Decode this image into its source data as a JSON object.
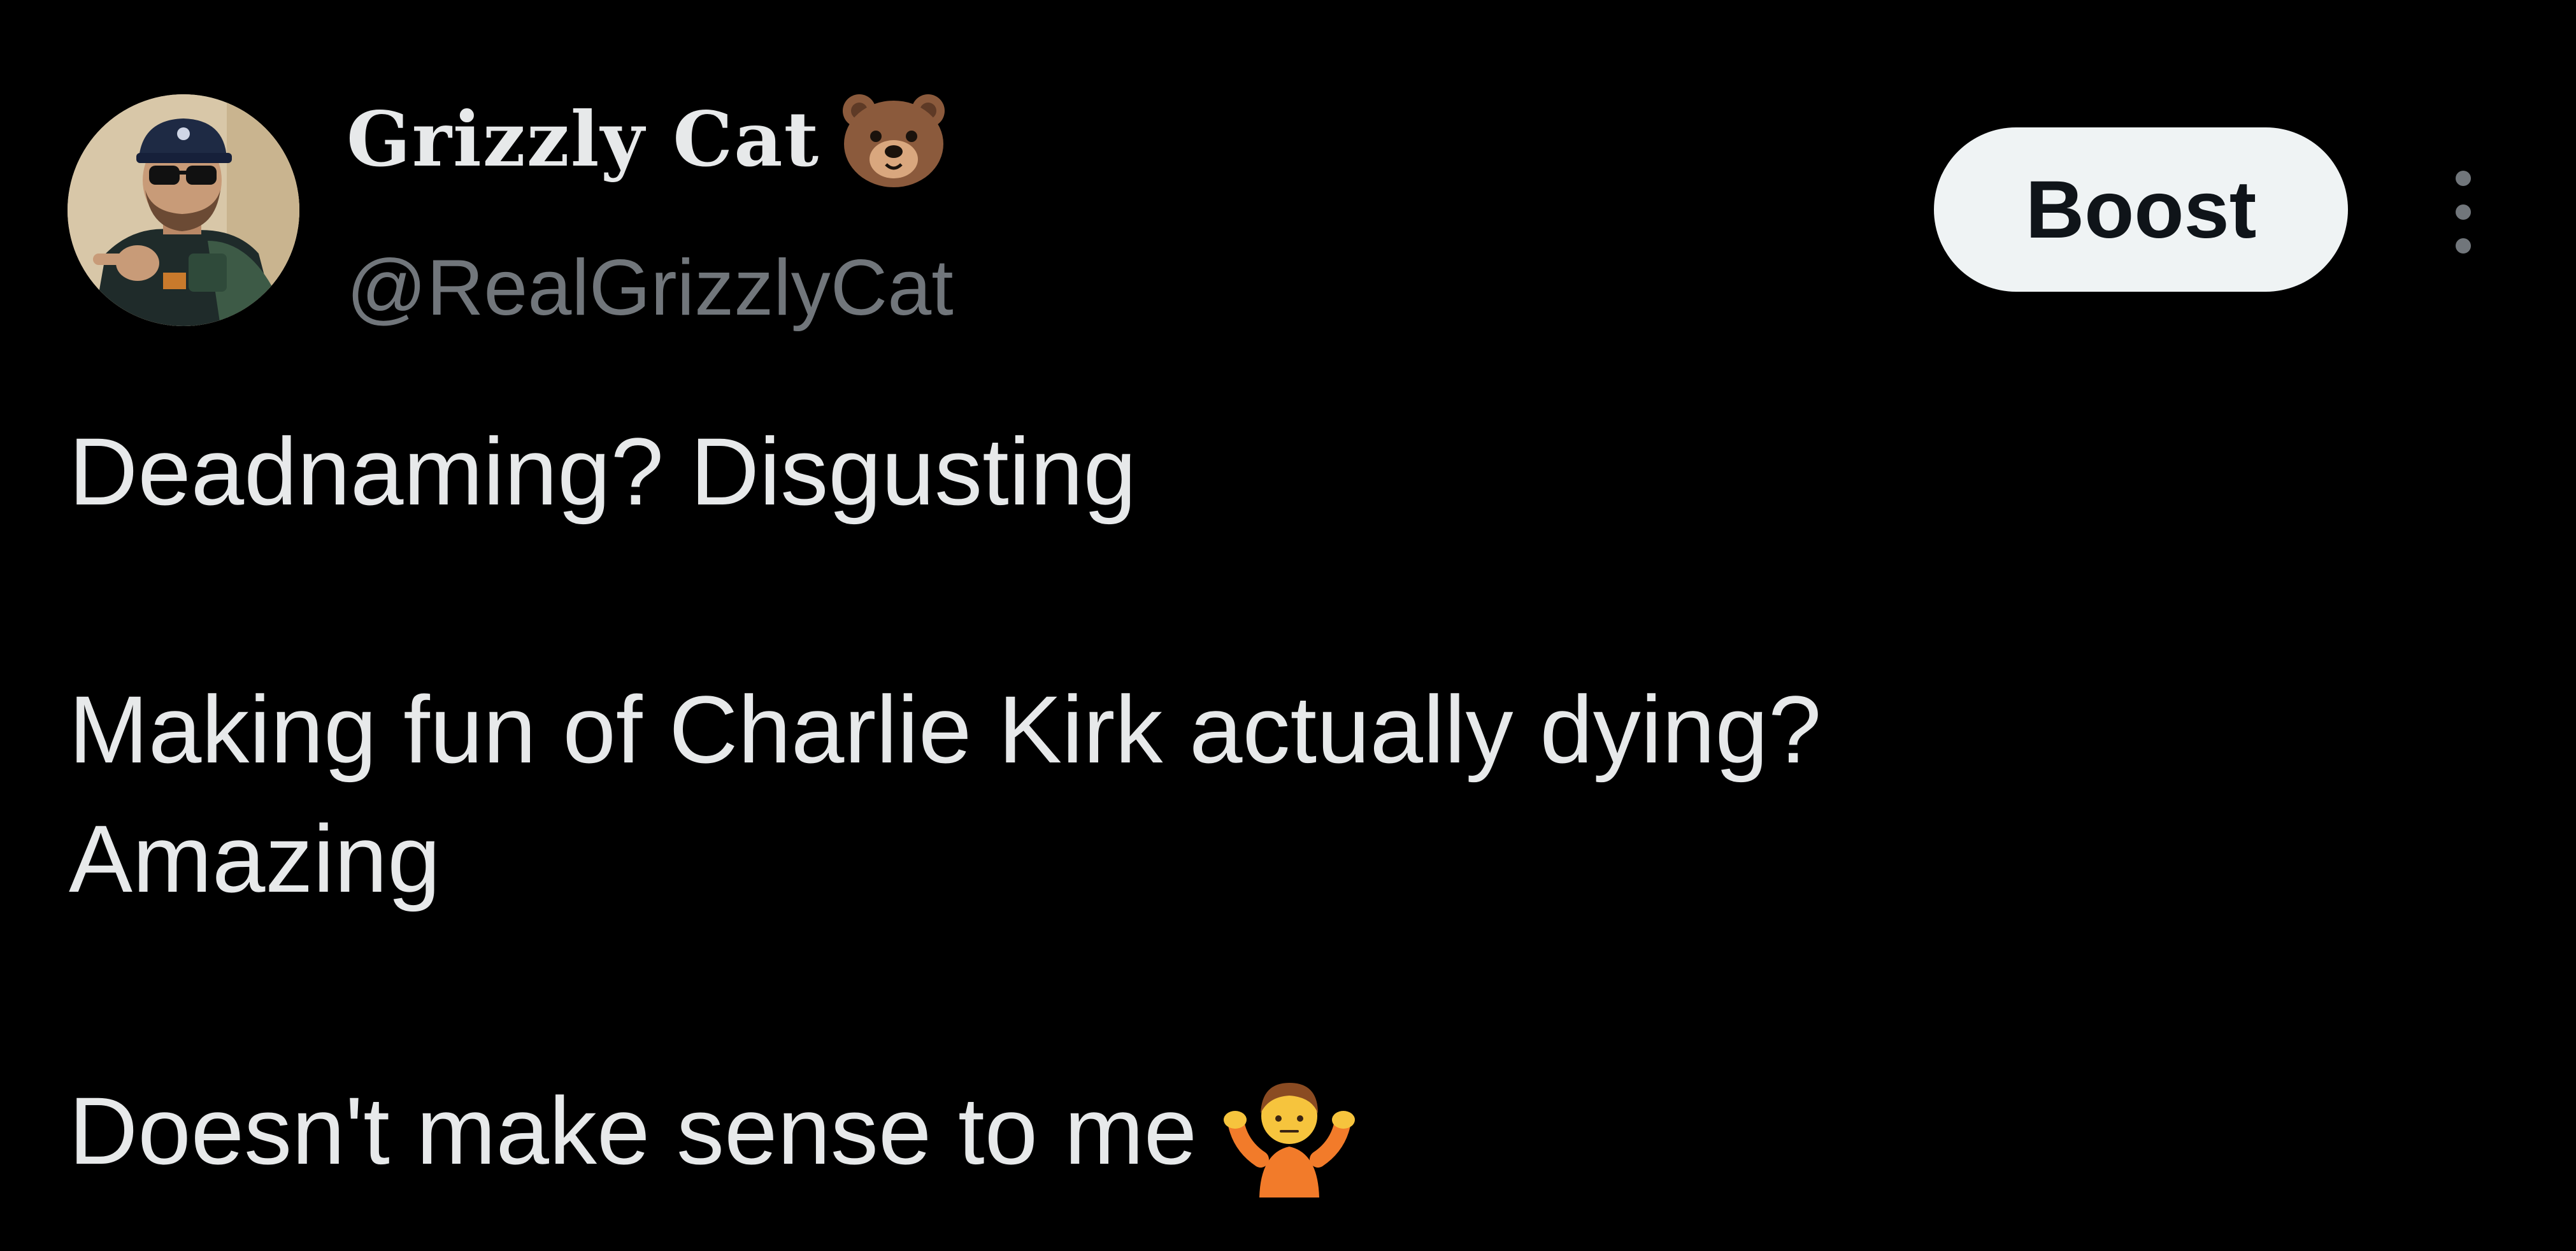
{
  "author": {
    "display_name": "Grizzly Cat",
    "name_emoji": "bear-face-emoji",
    "handle": "@RealGrizzlyCat",
    "avatar": "profile-photo"
  },
  "actions": {
    "boost_label": "Boost",
    "more_icon": "vertical-ellipsis-icon"
  },
  "post": {
    "line1": "Deadnaming? Disgusting",
    "line2": "Making fun of Charlie Kirk actually dying?",
    "line3": "Amazing",
    "line4": "Doesn't make sense to me",
    "line4_emoji": "person-shrugging-emoji"
  },
  "colors": {
    "background": "#000000",
    "primary_text": "#e7e9ea",
    "secondary_text": "#71767b",
    "button_bg": "#eff3f4",
    "button_text": "#0f1419"
  }
}
